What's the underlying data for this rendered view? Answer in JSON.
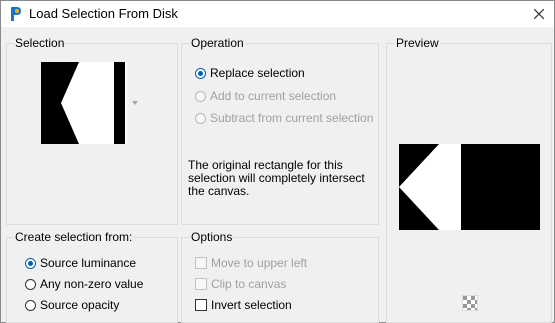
{
  "window": {
    "title": "Load Selection From Disk",
    "app_icon": "paintshop-icon",
    "close_icon": "close-icon"
  },
  "selection_group": {
    "title": "Selection",
    "dropdown_icon": "chevron-down-icon"
  },
  "operation_group": {
    "title": "Operation",
    "options": [
      {
        "label": "Replace selection",
        "checked": true,
        "enabled": true
      },
      {
        "label": "Add to current selection",
        "checked": false,
        "enabled": false
      },
      {
        "label": "Subtract from current selection",
        "checked": false,
        "enabled": false
      }
    ],
    "info": "The original rectangle for this selection will completely intersect the canvas."
  },
  "preview_group": {
    "title": "Preview",
    "checker_icon": "transparency-checker-icon"
  },
  "create_group": {
    "title": "Create selection from:",
    "options": [
      {
        "label": "Source luminance",
        "checked": true
      },
      {
        "label": "Any non-zero value",
        "checked": false
      },
      {
        "label": "Source opacity",
        "checked": false
      }
    ]
  },
  "options_group": {
    "title": "Options",
    "checks": [
      {
        "label": "Move to upper left",
        "checked": false,
        "enabled": false
      },
      {
        "label": "Clip to canvas",
        "checked": false,
        "enabled": false
      },
      {
        "label": "Invert selection",
        "checked": false,
        "enabled": true
      }
    ]
  },
  "colors": {
    "accent": "#005fb8",
    "disabled_text": "#a0a0a0",
    "background": "#f0f0f0"
  }
}
